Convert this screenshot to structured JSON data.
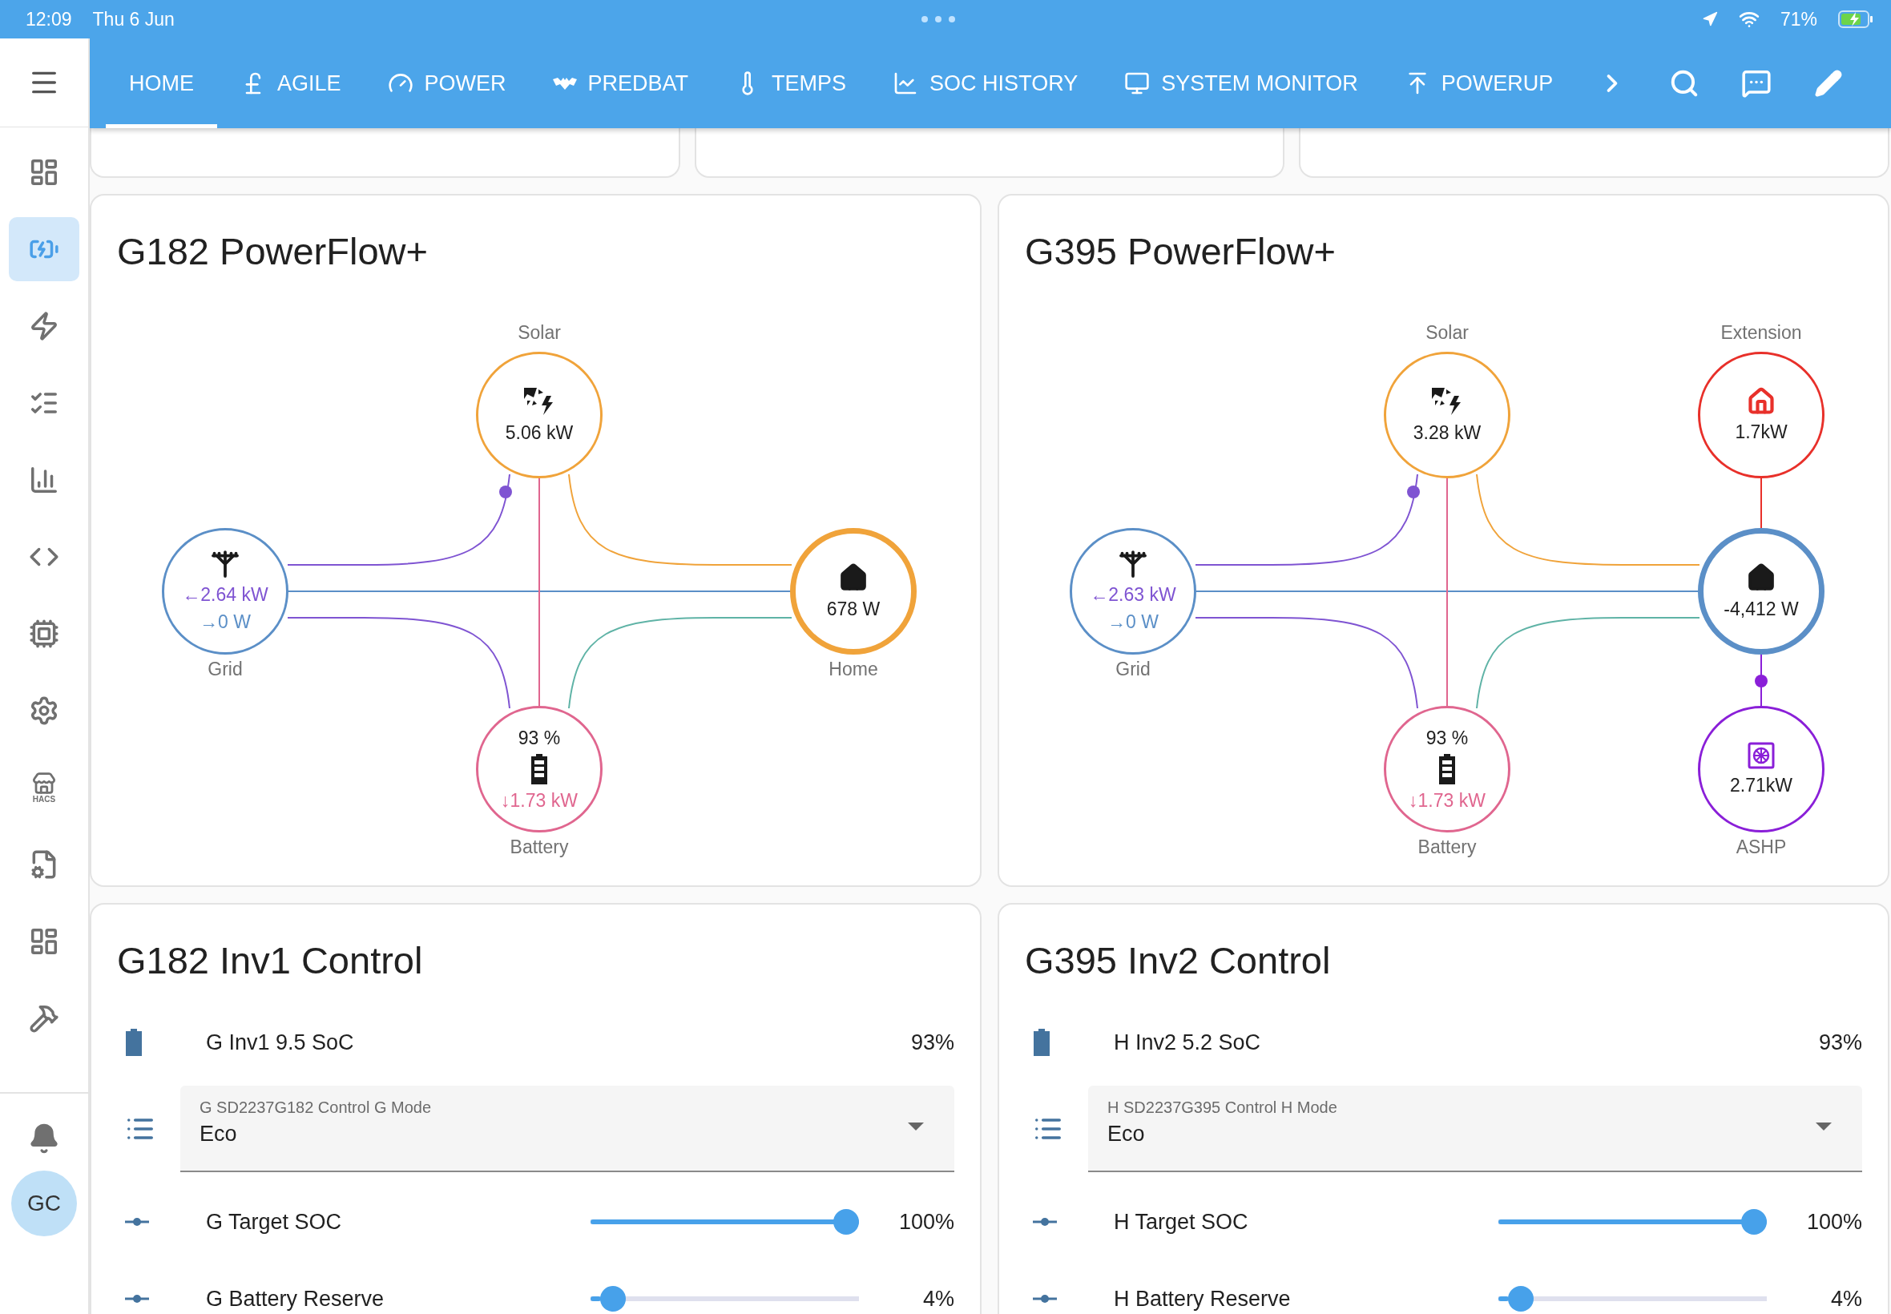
{
  "status_bar": {
    "time": "12:09",
    "date": "Thu 6 Jun",
    "battery": "71%"
  },
  "sidebar": {
    "items": [
      {
        "kind": "dashboard",
        "selected": false
      },
      {
        "kind": "battery-bolt",
        "selected": true
      },
      {
        "kind": "bolt",
        "selected": false
      },
      {
        "kind": "list",
        "selected": false
      },
      {
        "kind": "chart",
        "selected": false
      },
      {
        "kind": "code",
        "selected": false
      },
      {
        "kind": "chip",
        "selected": false
      },
      {
        "kind": "gear",
        "selected": false
      },
      {
        "kind": "store",
        "selected": false,
        "caption": "HACS"
      },
      {
        "kind": "file-cog",
        "selected": false
      },
      {
        "kind": "dashboard",
        "selected": false
      },
      {
        "kind": "hammer",
        "selected": false
      }
    ],
    "user": "GC"
  },
  "tabs": [
    {
      "label": "HOME",
      "selected": true
    },
    {
      "label": "AGILE",
      "selected": false
    },
    {
      "label": "POWER",
      "selected": false
    },
    {
      "label": "PREDBAT",
      "selected": false
    },
    {
      "label": "TEMPS",
      "selected": false
    },
    {
      "label": "SOC HISTORY",
      "selected": false
    },
    {
      "label": "SYSTEM MONITOR",
      "selected": false
    },
    {
      "label": "POWERUP",
      "selected": false
    }
  ],
  "powerflows": [
    {
      "title": "G182 PowerFlow+",
      "nodes": [
        {
          "kind": "solar",
          "label": "Solar",
          "color": "#f0a33a",
          "lines": [
            {
              "text": "5.06 kW",
              "color": "#212121"
            }
          ]
        },
        {
          "kind": "grid",
          "label": "Grid",
          "color": "#5b8fc7",
          "lines": [
            {
              "text": "←2.64 kW",
              "color": "#7f54d2"
            },
            {
              "text": "→0 W",
              "color": "#5b8fc7"
            }
          ]
        },
        {
          "kind": "home",
          "label": "Home",
          "color": "#f0a33a",
          "lines": [
            {
              "text": "678 W",
              "color": "#212121"
            }
          ]
        },
        {
          "kind": "battery",
          "label": "Battery",
          "color": "#e0668f",
          "lines": [
            {
              "text": "93 %",
              "color": "#212121"
            },
            {
              "text": "↓1.73 kW",
              "color": "#e0668f"
            }
          ]
        }
      ]
    },
    {
      "title": "G395 PowerFlow+",
      "nodes": [
        {
          "kind": "solar",
          "label": "Solar",
          "color": "#f0a33a",
          "lines": [
            {
              "text": "3.28 kW",
              "color": "#212121"
            }
          ]
        },
        {
          "kind": "extension",
          "label": "Extension",
          "color": "#e8302a",
          "lines": [
            {
              "text": "1.7kW",
              "color": "#212121"
            }
          ]
        },
        {
          "kind": "grid",
          "label": "Grid",
          "color": "#5b8fc7",
          "lines": [
            {
              "text": "←2.63 kW",
              "color": "#7f54d2"
            },
            {
              "text": "→0 W",
              "color": "#5b8fc7"
            }
          ]
        },
        {
          "kind": "home",
          "color": "#5b8fc7",
          "lines": [
            {
              "text": "-4,412 W",
              "color": "#212121"
            }
          ]
        },
        {
          "kind": "battery",
          "label": "Battery",
          "color": "#e0668f",
          "lines": [
            {
              "text": "93 %",
              "color": "#212121"
            },
            {
              "text": "↓1.73 kW",
              "color": "#e0668f"
            }
          ]
        },
        {
          "kind": "ashp",
          "label": "ASHP",
          "color": "#8a1fd8",
          "lines": [
            {
              "text": "2.71kW",
              "color": "#212121"
            }
          ]
        }
      ]
    }
  ],
  "controls": [
    {
      "title": "G182 Inv1 Control",
      "rows": [
        {
          "kind": "sensor",
          "label": "G Inv1 9.5 SoC",
          "value": "93%"
        },
        {
          "kind": "select",
          "label": "G SD2237G182 Control G Mode",
          "value": "Eco"
        },
        {
          "kind": "slider",
          "label": "G Target SOC",
          "level": 1,
          "value": "100%"
        },
        {
          "kind": "slider",
          "label": "G Battery Reserve",
          "level": 0.04,
          "value": "4%"
        }
      ]
    },
    {
      "title": "G395 Inv2 Control",
      "rows": [
        {
          "kind": "sensor",
          "label": "H Inv2 5.2 SoC",
          "value": "93%"
        },
        {
          "kind": "select",
          "label": "H SD2237G395 Control H Mode",
          "value": "Eco"
        },
        {
          "kind": "slider",
          "label": "H Target SOC",
          "level": 1,
          "value": "100%"
        },
        {
          "kind": "slider",
          "label": "H Battery Reserve",
          "level": 0.04,
          "value": "4%"
        }
      ]
    }
  ]
}
